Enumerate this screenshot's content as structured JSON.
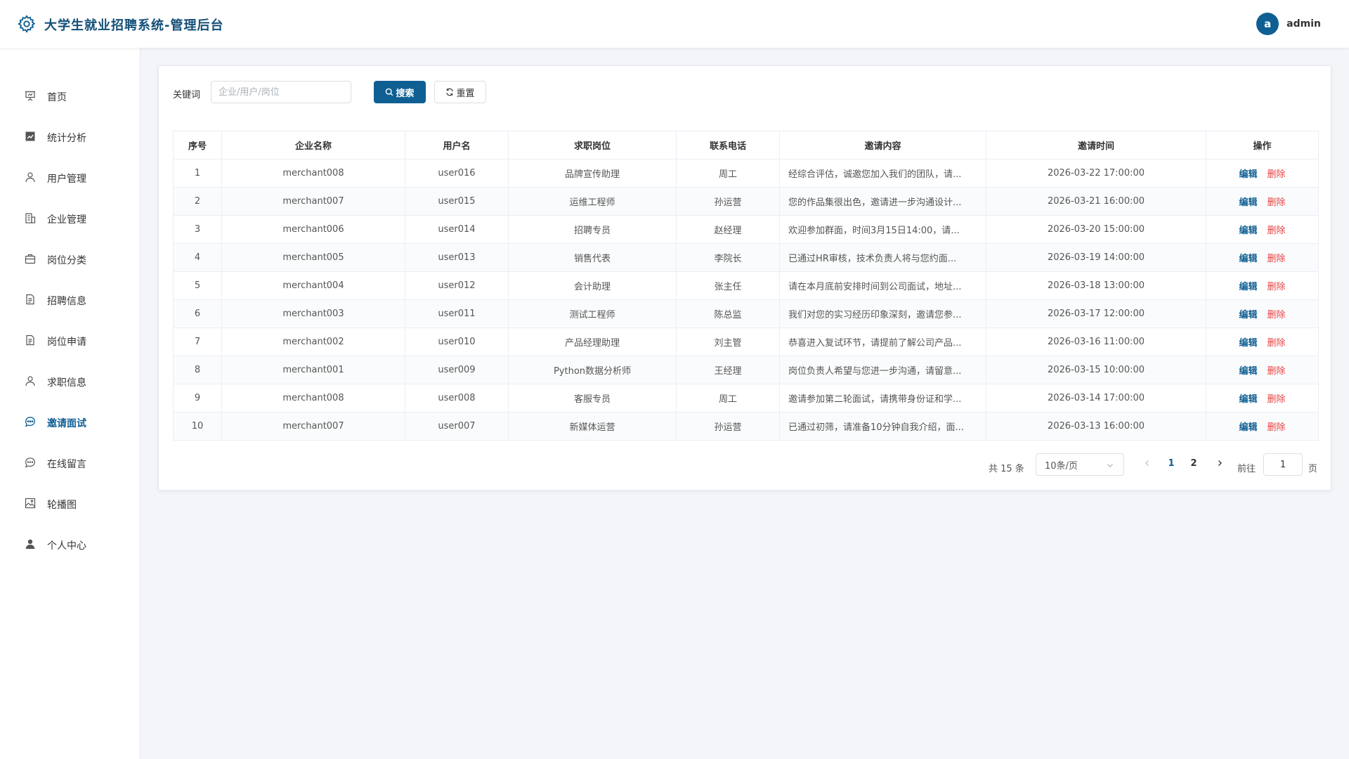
{
  "header": {
    "logo_icon": "gear-icon",
    "title": "大学生就业招聘系统-管理后台",
    "avatar_letter": "a",
    "username": "admin"
  },
  "sidebar": {
    "items": [
      {
        "label": "首页",
        "icon": "presentation-chart-icon"
      },
      {
        "label": "统计分析",
        "icon": "trend-chart-icon"
      },
      {
        "label": "用户管理",
        "icon": "user-icon"
      },
      {
        "label": "企业管理",
        "icon": "building-icon"
      },
      {
        "label": "岗位分类",
        "icon": "briefcase-icon"
      },
      {
        "label": "招聘信息",
        "icon": "document-icon"
      },
      {
        "label": "岗位申请",
        "icon": "document-icon"
      },
      {
        "label": "求职信息",
        "icon": "user-icon"
      },
      {
        "label": "邀请面试",
        "icon": "chat-bubble-icon",
        "active": true
      },
      {
        "label": "在线留言",
        "icon": "chat-bubble-icon"
      },
      {
        "label": "轮播图",
        "icon": "image-icon"
      },
      {
        "label": "个人中心",
        "icon": "user-filled-icon"
      }
    ]
  },
  "search": {
    "label": "关键词",
    "value": "",
    "placeholder": "企业/用户/岗位",
    "search_button": "搜索",
    "reset_button": "重置"
  },
  "table": {
    "columns": [
      "序号",
      "企业名称",
      "用户名",
      "求职岗位",
      "联系电话",
      "邀请内容",
      "邀请时间",
      "操作"
    ],
    "edit_label": "编辑",
    "delete_label": "删除",
    "rows": [
      {
        "index": "1",
        "company": "merchant008",
        "user": "user016",
        "job": "品牌宣传助理",
        "phone": "周工",
        "content": "经综合评估，诚邀您加入我们的团队，请...",
        "time": "2026-03-22 17:00:00"
      },
      {
        "index": "2",
        "company": "merchant007",
        "user": "user015",
        "job": "运维工程师",
        "phone": "孙运营",
        "content": "您的作品集很出色，邀请进一步沟通设计...",
        "time": "2026-03-21 16:00:00"
      },
      {
        "index": "3",
        "company": "merchant006",
        "user": "user014",
        "job": "招聘专员",
        "phone": "赵经理",
        "content": "欢迎参加群面，时间3月15日14:00，请...",
        "time": "2026-03-20 15:00:00"
      },
      {
        "index": "4",
        "company": "merchant005",
        "user": "user013",
        "job": "销售代表",
        "phone": "李院长",
        "content": "已通过HR审核，技术负责人将与您约面...",
        "time": "2026-03-19 14:00:00"
      },
      {
        "index": "5",
        "company": "merchant004",
        "user": "user012",
        "job": "会计助理",
        "phone": "张主任",
        "content": "请在本月底前安排时间到公司面试，地址...",
        "time": "2026-03-18 13:00:00"
      },
      {
        "index": "6",
        "company": "merchant003",
        "user": "user011",
        "job": "测试工程师",
        "phone": "陈总监",
        "content": "我们对您的实习经历印象深刻，邀请您参...",
        "time": "2026-03-17 12:00:00"
      },
      {
        "index": "7",
        "company": "merchant002",
        "user": "user010",
        "job": "产品经理助理",
        "phone": "刘主管",
        "content": "恭喜进入复试环节，请提前了解公司产品...",
        "time": "2026-03-16 11:00:00"
      },
      {
        "index": "8",
        "company": "merchant001",
        "user": "user009",
        "job": "Python数据分析师",
        "phone": "王经理",
        "content": "岗位负责人希望与您进一步沟通，请留意...",
        "time": "2026-03-15 10:00:00"
      },
      {
        "index": "9",
        "company": "merchant008",
        "user": "user008",
        "job": "客服专员",
        "phone": "周工",
        "content": "邀请参加第二轮面试，请携带身份证和学...",
        "time": "2026-03-14 17:00:00"
      },
      {
        "index": "10",
        "company": "merchant007",
        "user": "user007",
        "job": "新媒体运营",
        "phone": "孙运营",
        "content": "已通过初筛，请准备10分钟自我介绍，面...",
        "time": "2026-03-13 16:00:00"
      }
    ]
  },
  "pagination": {
    "total_text": "共 15 条",
    "page_size": "10条/页",
    "pages": [
      "1",
      "2"
    ],
    "current_page": "1",
    "goto_label": "前往",
    "goto_value": "1",
    "page_unit": "页"
  },
  "colors": {
    "primary": "#0f5f93",
    "danger": "#e64242",
    "title": "#134f78"
  }
}
